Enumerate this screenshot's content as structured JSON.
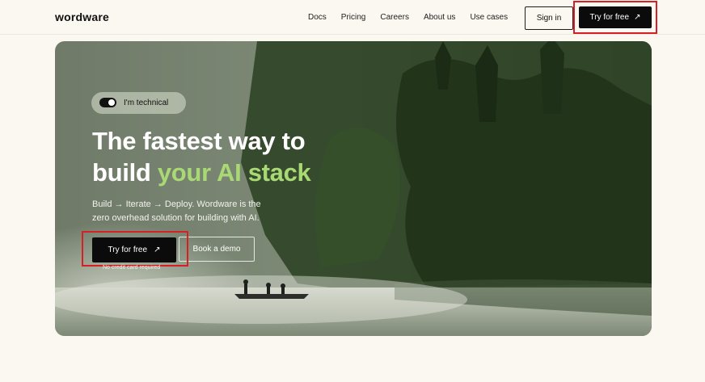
{
  "header": {
    "logo": "wordware",
    "nav": [
      "Docs",
      "Pricing",
      "Careers",
      "About us",
      "Use cases"
    ],
    "signin_label": "Sign in",
    "try_label": "Try for free",
    "try_icon": "arrow-up-right-icon"
  },
  "hero": {
    "toggle_label": "I'm technical",
    "headline_line1": "The fastest way to",
    "headline_line2_a": "build ",
    "headline_line2_b": "your AI stack",
    "sub_line1": "Build → Iterate → Deploy. Wordware is the",
    "sub_line2": "zero overhead solution for building with AI.",
    "try_label": "Try for free",
    "demo_label": "Book a demo",
    "no_card": "No credit card required"
  },
  "colors": {
    "accent_green": "#a9d975",
    "button_black": "#0b0b0b",
    "highlight_red": "#d81f26",
    "page_bg": "#fbf8f1"
  }
}
